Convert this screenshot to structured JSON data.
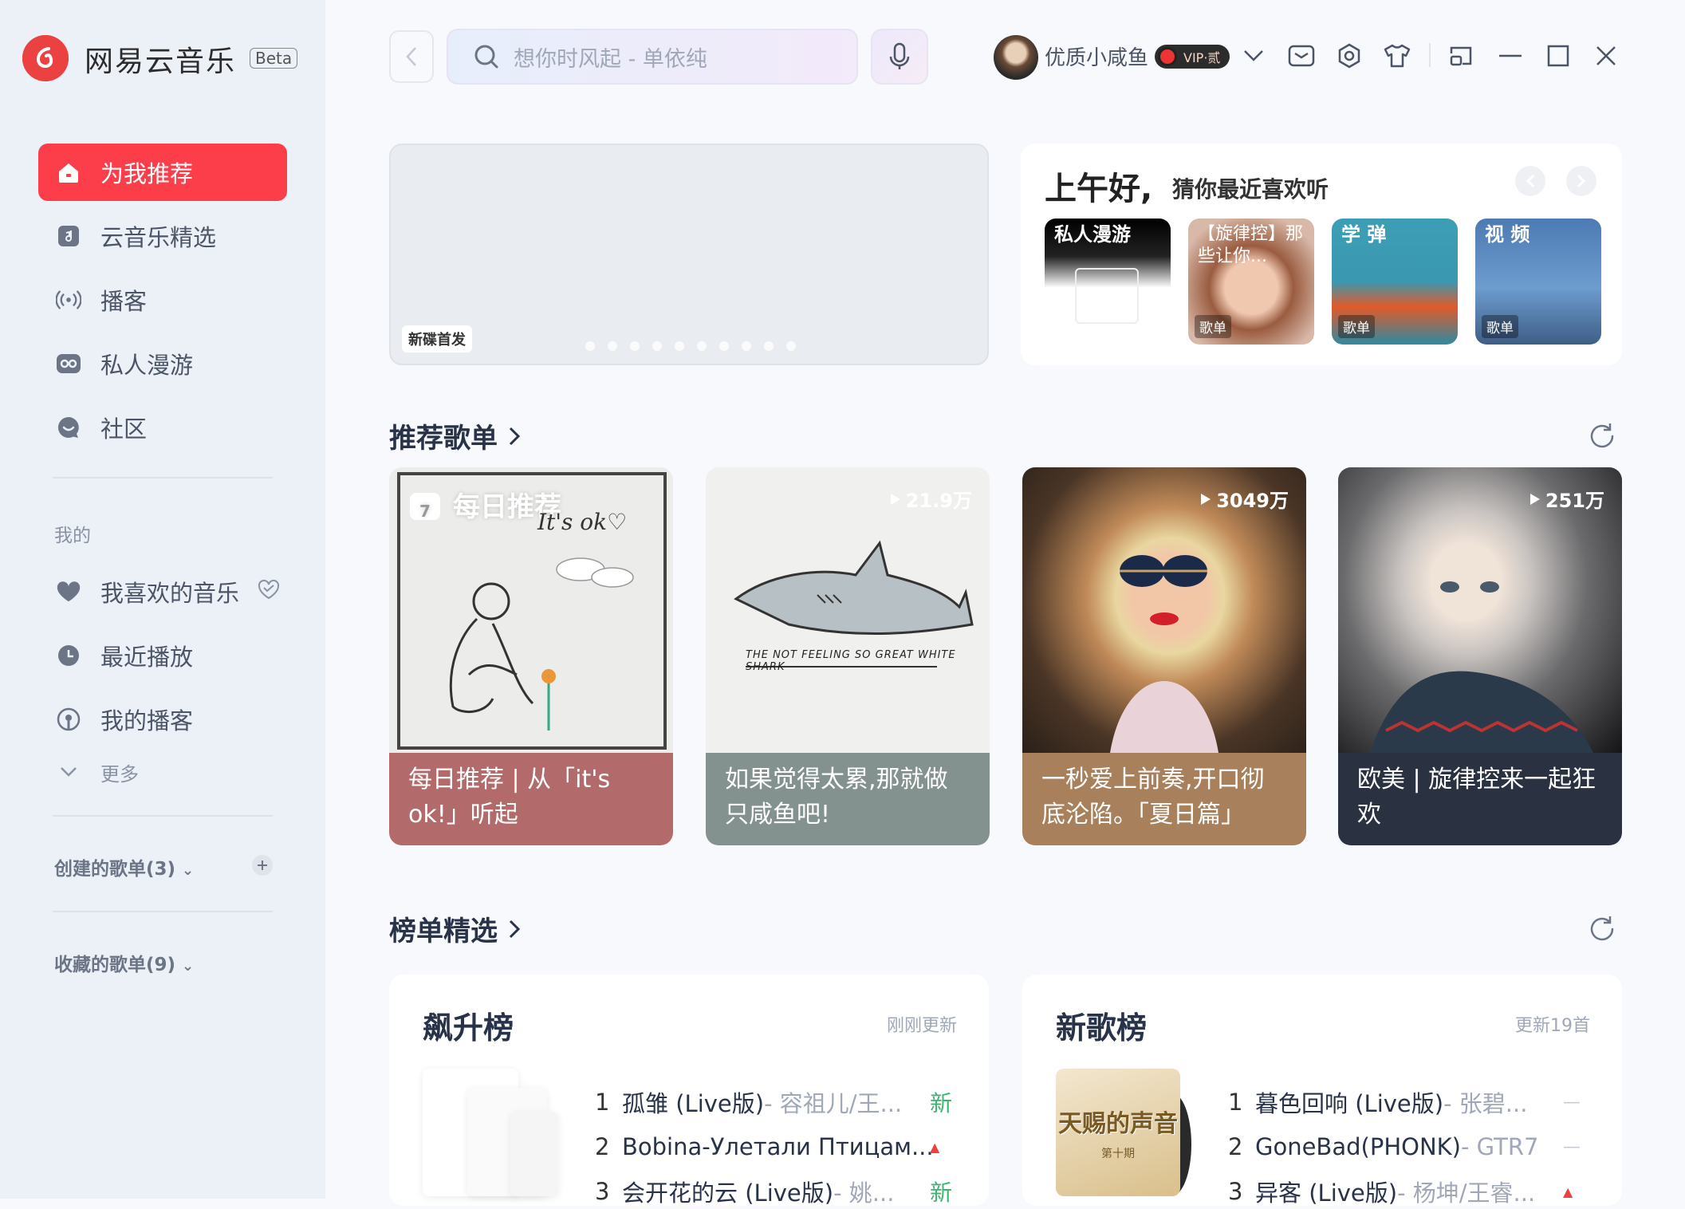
{
  "app": {
    "name": "网易云音乐",
    "beta": "Beta",
    "brand_color": "#fc3d4a"
  },
  "sidebar": {
    "nav": [
      {
        "label": "为我推荐",
        "icon": "home-icon",
        "active": true
      },
      {
        "label": "云音乐精选",
        "icon": "music-note-icon"
      },
      {
        "label": "播客",
        "icon": "podcast-icon"
      },
      {
        "label": "私人漫游",
        "icon": "roam-icon"
      },
      {
        "label": "社区",
        "icon": "community-icon"
      }
    ],
    "mine_label": "我的",
    "mine": [
      {
        "label": "我喜欢的音乐",
        "icon": "heart-icon"
      },
      {
        "label": "最近播放",
        "icon": "clock-icon"
      },
      {
        "label": "我的播客",
        "icon": "my-podcast-icon"
      }
    ],
    "more": "更多",
    "created_playlists": "创建的歌单(3)",
    "collected_playlists": "收藏的歌单(9)"
  },
  "topbar": {
    "search_placeholder": "想你时风起 - 单依纯",
    "username": "优质小咸鱼",
    "vip": "VIP·贰"
  },
  "banner": {
    "tag": "新碟首发",
    "dot_count": 10
  },
  "greeting": {
    "title": "上午好,",
    "subtitle": "猜你最近喜欢听",
    "tiles": [
      {
        "title": "私人漫游",
        "tag": ""
      },
      {
        "title": "【旋律控】那些让你...",
        "tag": "歌单"
      },
      {
        "title": "学 弹",
        "tag": "歌单"
      },
      {
        "title": "视 频",
        "tag": "歌单"
      }
    ]
  },
  "recommended": {
    "title": "推荐歌单",
    "cards": [
      {
        "cover_label": "每日推荐",
        "cover_text": "It's ok♡",
        "caption": "每日推荐 | 从「it's ok!」听起",
        "playcount": "",
        "caption_color": "#b26a6a"
      },
      {
        "cover_text": "THE NOT FEELING SO GREAT WHITE SHARK",
        "caption": "如果觉得太累,那就做只咸鱼吧!",
        "playcount": "21.9万",
        "caption_color": "#84928f"
      },
      {
        "caption": "一秒爱上前奏,开口彻底沦陷。「夏日篇」",
        "playcount": "3049万",
        "caption_color": "#a8815c"
      },
      {
        "caption": "欧美 | 旋律控来一起狂欢",
        "playcount": "251万",
        "caption_color": "#2a3140"
      }
    ]
  },
  "charts": {
    "title": "榜单精选",
    "lists": [
      {
        "name": "飙升榜",
        "updated": "刚刚更新",
        "rows": [
          {
            "rank": "1",
            "song": "孤雏 (Live版)",
            "artist": " - 容祖儿/王...",
            "status": "新"
          },
          {
            "rank": "2",
            "song": "Bobina-Улетали Птицам...",
            "artist": "",
            "status": "▲"
          },
          {
            "rank": "3",
            "song": "会开花的云 (Live版)",
            "artist": " - 姚...",
            "status": "新"
          }
        ]
      },
      {
        "name": "新歌榜",
        "updated": "更新19首",
        "cover_text": "天赐的声音",
        "cover_sub": "第十期",
        "rows": [
          {
            "rank": "1",
            "song": "暮色回响 (Live版)",
            "artist": " - 张碧...",
            "status": "—"
          },
          {
            "rank": "2",
            "song": "GoneBad(PHONK)",
            "artist": " - GTR7",
            "status": "—"
          },
          {
            "rank": "3",
            "song": "异客 (Live版)",
            "artist": " - 杨坤/王睿...",
            "status": "▲"
          }
        ]
      }
    ]
  }
}
